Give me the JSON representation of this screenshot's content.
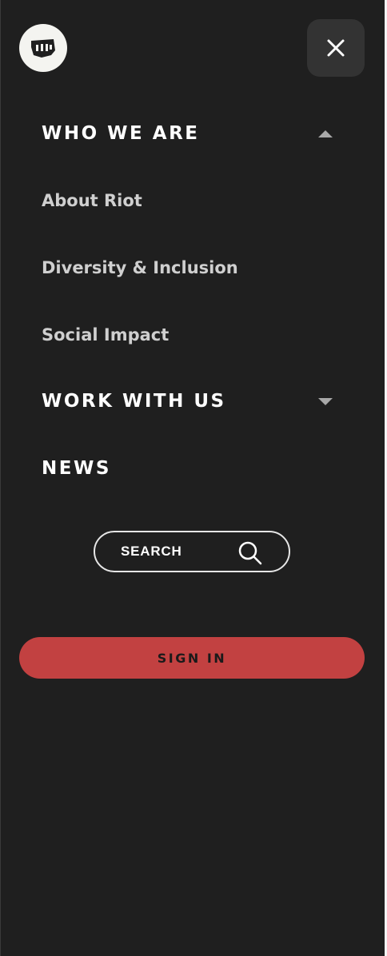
{
  "logo": {
    "icon": "riot-fist-icon"
  },
  "close": {
    "icon": "close-icon"
  },
  "nav": {
    "who_we_are": {
      "label": "WHO WE ARE",
      "expanded": true,
      "icon": "caret-up-icon",
      "items": [
        {
          "label": "About Riot"
        },
        {
          "label": "Diversity & Inclusion"
        },
        {
          "label": "Social Impact"
        }
      ]
    },
    "work_with_us": {
      "label": "WORK WITH US",
      "expanded": false,
      "icon": "caret-down-icon"
    },
    "news": {
      "label": "NEWS"
    }
  },
  "search": {
    "label": "SEARCH",
    "icon": "search-icon"
  },
  "signin": {
    "label": "SIGN IN"
  },
  "colors": {
    "background": "#1f1f1f",
    "accent": "#c24141",
    "close_button": "#333333",
    "logo_circle": "#f4f4f0",
    "sub_text": "#cfcfcf"
  }
}
